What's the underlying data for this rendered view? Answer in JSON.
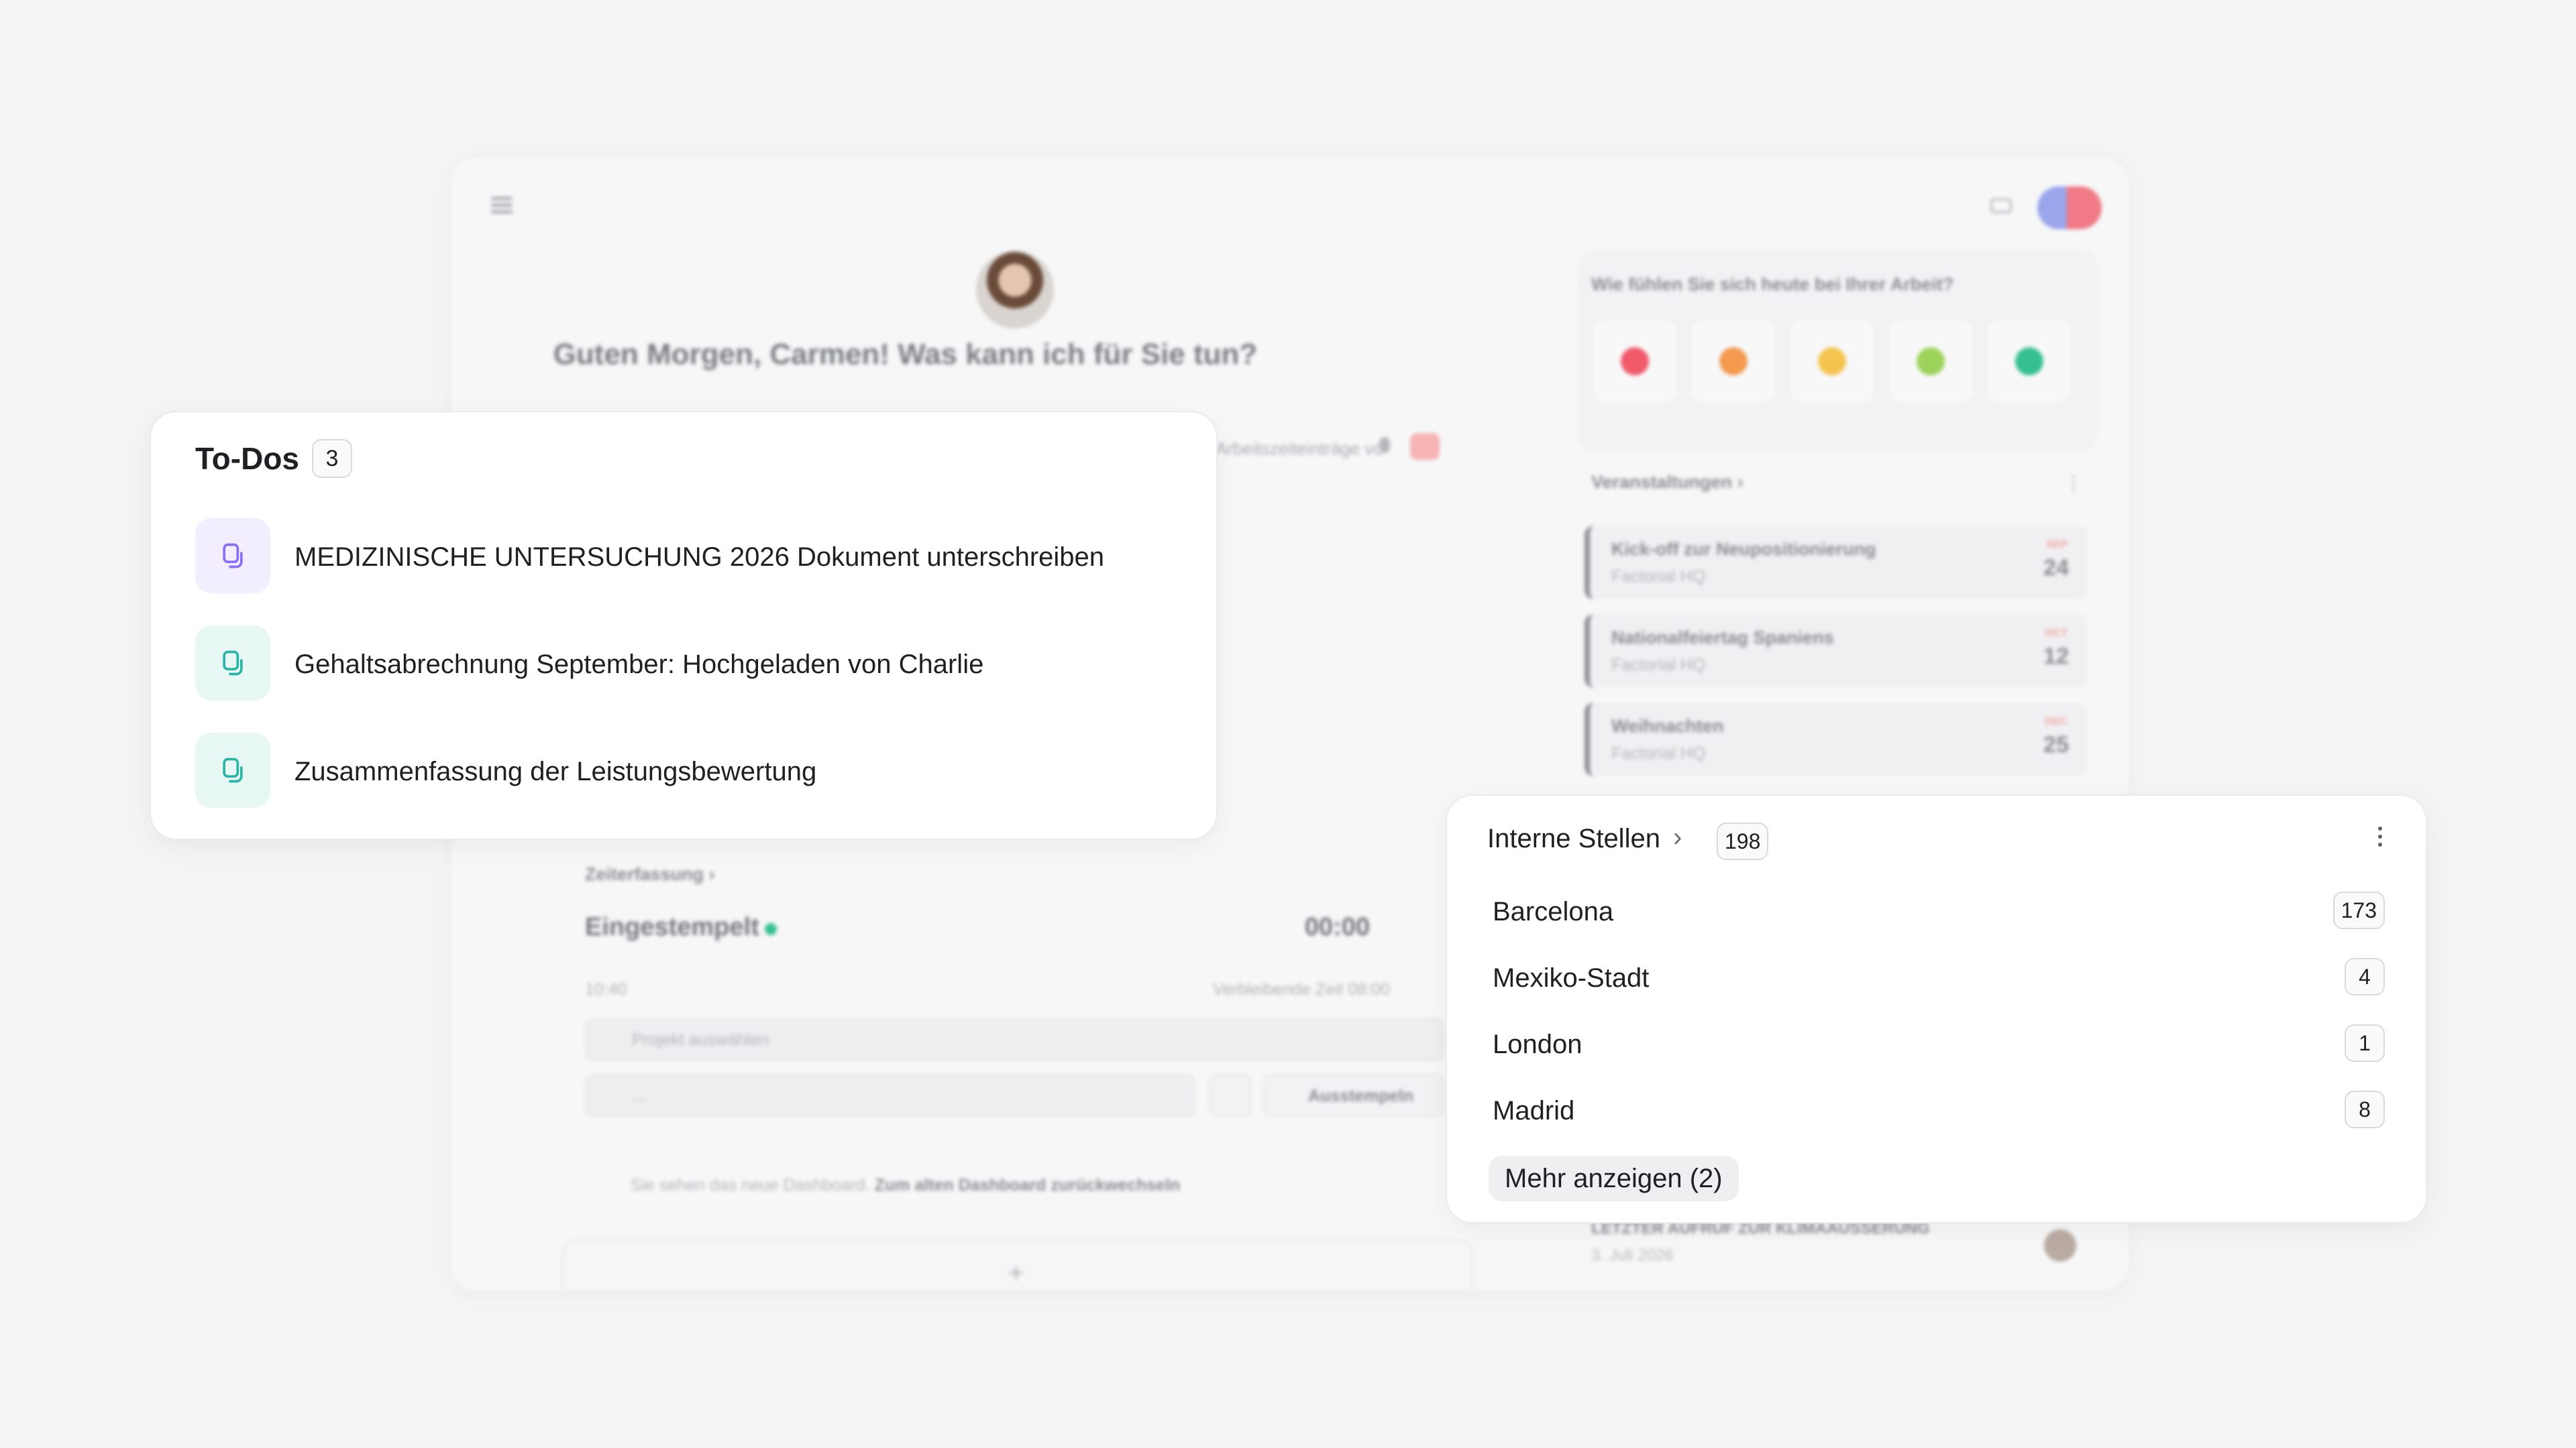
{
  "dashboard": {
    "greeting": "Guten Morgen, Carmen!  Was kann ich für Sie tun?",
    "input_hint": "Arbeitszeiteinträge vo",
    "mood": {
      "question": "Wie fühlen Sie sich heute bei Ihrer Arbeit?",
      "colors": [
        "#f05a6a",
        "#f39a4e",
        "#f5c44f",
        "#9dd35a",
        "#35c08f"
      ]
    },
    "events": {
      "title": "Veranstaltungen",
      "items": [
        {
          "title": "Kick-off zur Neupositionierung",
          "location": "Factorial HQ",
          "month": "SEP",
          "day": "24"
        },
        {
          "title": "Nationalfeiertag Spaniens",
          "location": "Factorial HQ",
          "month": "OCT",
          "day": "12"
        },
        {
          "title": "Weihnachten",
          "location": "Factorial HQ",
          "month": "DEC",
          "day": "25"
        }
      ]
    },
    "time_tracking": {
      "title": "Zeiterfassung",
      "status": "Eingestempelt",
      "elapsed": "00:00",
      "start": "10:40",
      "remaining": "Verbleibende Zeit 08:00",
      "project_placeholder": "Projekt auswählen",
      "location_placeholder": "...",
      "clock_out_label": "Ausstempeln"
    },
    "note_prefix": "Sie sehen das neue Dashboard.",
    "note_link": "Zum alten Dashboard zurückwechseln",
    "add_label": "+",
    "news": {
      "title": "LETZTER AUFRUF ZUR KLIMAAUSSERUNG",
      "date": "3. Juli 2026"
    }
  },
  "todos": {
    "title": "To-Dos",
    "count": "3",
    "items": [
      {
        "text": "MEDIZINISCHE UNTERSUCHUNG 2026 Dokument unterschreiben",
        "icon": "document-icon",
        "tone": "purple"
      },
      {
        "text": "Gehaltsabrechnung September: Hochgeladen von Charlie",
        "icon": "document-icon",
        "tone": "teal"
      },
      {
        "text": "Zusammenfassung der Leistungsbewertung",
        "icon": "document-icon",
        "tone": "teal"
      }
    ]
  },
  "postings": {
    "title": "Interne Stellen",
    "count": "198",
    "locations": [
      {
        "name": "Barcelona",
        "count": "173"
      },
      {
        "name": "Mexiko-Stadt",
        "count": "4"
      },
      {
        "name": "London",
        "count": "1"
      },
      {
        "name": "Madrid",
        "count": "8"
      }
    ],
    "show_more": "Mehr anzeigen (2)"
  },
  "colors": {
    "purple_icon": "#8b6cf6",
    "teal_icon": "#2bb3a3",
    "status_green": "#35c08f"
  }
}
